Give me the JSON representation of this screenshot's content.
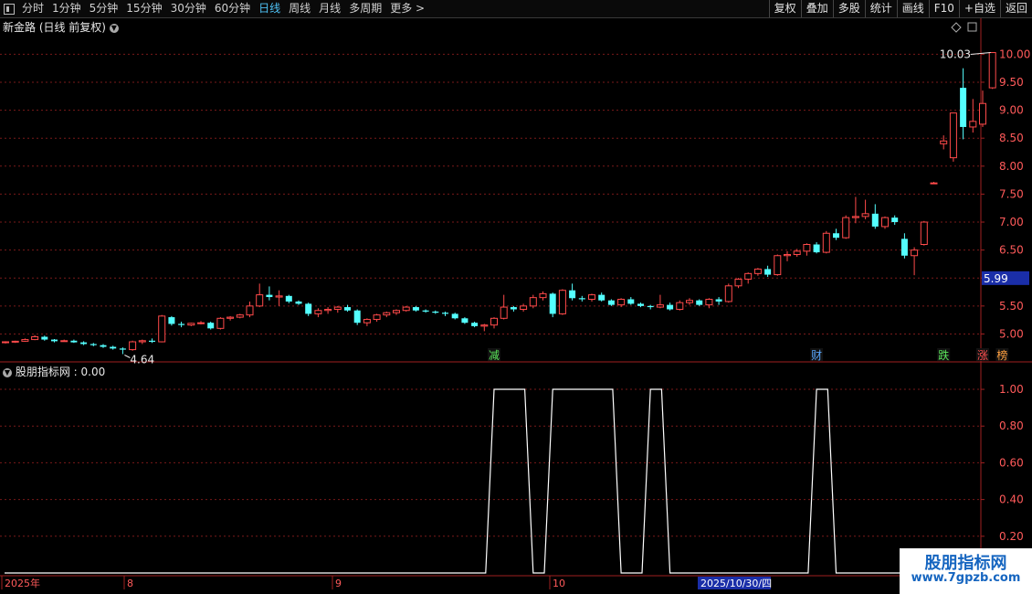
{
  "toolbar": {
    "periods": [
      "分时",
      "1分钟",
      "5分钟",
      "15分钟",
      "30分钟",
      "60分钟",
      "日线",
      "周线",
      "月线",
      "多周期",
      "更多 >"
    ],
    "active_period": "日线",
    "actions": [
      "复权",
      "叠加",
      "多股",
      "统计",
      "画线",
      "F10",
      "+自选",
      "返回"
    ]
  },
  "stock_title": "新金路 (日线 前复权)",
  "indicator_title": "股朋指标网 : 0.00",
  "watermark": {
    "line1": "股朋指标网",
    "line2": "www.7gpzb.com"
  },
  "colors": {
    "up": "#ff4a4a",
    "down": "#54ffff",
    "grid": "#7a1a1a",
    "axis": "#a02020",
    "line": "#ffffff",
    "price_tag_bg": "#1a2ea8"
  },
  "chart_data": [
    {
      "type": "candlestick",
      "title": "新金路 (日线 前复权)",
      "y_ticks": [
        "10.00",
        "9.50",
        "9.00",
        "8.50",
        "8.00",
        "7.50",
        "7.00",
        "6.50",
        "6.00",
        "5.50",
        "5.00"
      ],
      "ylim": [
        4.55,
        10.3
      ],
      "current_price_tag": "5.99",
      "annotations": {
        "high": "10.03",
        "low": "4.64"
      },
      "events": [
        {
          "index": 50,
          "label": "减",
          "color": "#5ce65c"
        },
        {
          "index": 83,
          "label": "财",
          "color": "#5aa8ff"
        },
        {
          "index": 96,
          "label": "跌",
          "color": "#5ce65c"
        },
        {
          "index": 100,
          "label": "涨",
          "color": "#ff5050"
        },
        {
          "index": 102,
          "label": "榜",
          "color": "#ffa040"
        }
      ],
      "candles": [
        [
          4.85,
          4.87,
          4.83,
          4.86
        ],
        [
          4.86,
          4.88,
          4.84,
          4.87
        ],
        [
          4.87,
          4.92,
          4.86,
          4.9
        ],
        [
          4.9,
          4.98,
          4.89,
          4.95
        ],
        [
          4.95,
          4.97,
          4.88,
          4.9
        ],
        [
          4.9,
          4.91,
          4.85,
          4.87
        ],
        [
          4.87,
          4.9,
          4.86,
          4.88
        ],
        [
          4.88,
          4.9,
          4.84,
          4.85
        ],
        [
          4.85,
          4.87,
          4.8,
          4.82
        ],
        [
          4.82,
          4.84,
          4.78,
          4.8
        ],
        [
          4.8,
          4.82,
          4.75,
          4.77
        ],
        [
          4.77,
          4.79,
          4.72,
          4.74
        ],
        [
          4.74,
          4.76,
          4.64,
          4.72
        ],
        [
          4.72,
          4.88,
          4.7,
          4.86
        ],
        [
          4.86,
          4.9,
          4.82,
          4.88
        ],
        [
          4.88,
          4.92,
          4.84,
          4.86
        ],
        [
          4.86,
          5.34,
          4.85,
          5.32
        ],
        [
          5.3,
          5.32,
          5.15,
          5.18
        ],
        [
          5.18,
          5.22,
          5.12,
          5.16
        ],
        [
          5.16,
          5.2,
          5.14,
          5.19
        ],
        [
          5.19,
          5.23,
          5.17,
          5.2
        ],
        [
          5.2,
          5.22,
          5.08,
          5.1
        ],
        [
          5.1,
          5.3,
          5.08,
          5.28
        ],
        [
          5.28,
          5.32,
          5.24,
          5.3
        ],
        [
          5.3,
          5.36,
          5.28,
          5.34
        ],
        [
          5.34,
          5.58,
          5.3,
          5.5
        ],
        [
          5.5,
          5.9,
          5.48,
          5.7
        ],
        [
          5.7,
          5.85,
          5.6,
          5.66
        ],
        [
          5.66,
          5.78,
          5.5,
          5.68
        ],
        [
          5.68,
          5.7,
          5.55,
          5.58
        ],
        [
          5.58,
          5.6,
          5.52,
          5.54
        ],
        [
          5.54,
          5.56,
          5.32,
          5.36
        ],
        [
          5.36,
          5.46,
          5.3,
          5.42
        ],
        [
          5.42,
          5.48,
          5.36,
          5.44
        ],
        [
          5.44,
          5.5,
          5.38,
          5.48
        ],
        [
          5.48,
          5.52,
          5.4,
          5.42
        ],
        [
          5.42,
          5.44,
          5.16,
          5.2
        ],
        [
          5.2,
          5.28,
          5.14,
          5.26
        ],
        [
          5.26,
          5.36,
          5.22,
          5.34
        ],
        [
          5.34,
          5.4,
          5.3,
          5.38
        ],
        [
          5.38,
          5.44,
          5.34,
          5.42
        ],
        [
          5.42,
          5.5,
          5.4,
          5.48
        ],
        [
          5.48,
          5.5,
          5.4,
          5.42
        ],
        [
          5.42,
          5.44,
          5.38,
          5.4
        ],
        [
          5.4,
          5.42,
          5.36,
          5.38
        ],
        [
          5.38,
          5.4,
          5.32,
          5.36
        ],
        [
          5.36,
          5.38,
          5.26,
          5.28
        ],
        [
          5.28,
          5.3,
          5.18,
          5.2
        ],
        [
          5.2,
          5.22,
          5.12,
          5.14
        ],
        [
          5.14,
          5.18,
          5.05,
          5.16
        ],
        [
          5.16,
          5.3,
          5.1,
          5.28
        ],
        [
          5.28,
          5.7,
          5.26,
          5.48
        ],
        [
          5.48,
          5.5,
          5.4,
          5.44
        ],
        [
          5.44,
          5.54,
          5.4,
          5.5
        ],
        [
          5.5,
          5.7,
          5.46,
          5.65
        ],
        [
          5.65,
          5.76,
          5.6,
          5.72
        ],
        [
          5.72,
          5.74,
          5.3,
          5.36
        ],
        [
          5.36,
          5.8,
          5.34,
          5.78
        ],
        [
          5.78,
          5.9,
          5.6,
          5.64
        ],
        [
          5.64,
          5.68,
          5.58,
          5.62
        ],
        [
          5.62,
          5.72,
          5.58,
          5.7
        ],
        [
          5.7,
          5.74,
          5.58,
          5.6
        ],
        [
          5.6,
          5.62,
          5.5,
          5.52
        ],
        [
          5.52,
          5.64,
          5.48,
          5.62
        ],
        [
          5.62,
          5.66,
          5.52,
          5.54
        ],
        [
          5.54,
          5.56,
          5.48,
          5.5
        ],
        [
          5.5,
          5.52,
          5.44,
          5.48
        ],
        [
          5.48,
          5.7,
          5.46,
          5.52
        ],
        [
          5.52,
          5.56,
          5.42,
          5.44
        ],
        [
          5.44,
          5.6,
          5.42,
          5.56
        ],
        [
          5.56,
          5.64,
          5.52,
          5.6
        ],
        [
          5.6,
          5.62,
          5.5,
          5.52
        ],
        [
          5.52,
          5.64,
          5.46,
          5.62
        ],
        [
          5.62,
          5.66,
          5.52,
          5.58
        ],
        [
          5.58,
          5.9,
          5.56,
          5.86
        ],
        [
          5.86,
          6.0,
          5.82,
          5.98
        ],
        [
          5.98,
          6.1,
          5.9,
          6.08
        ],
        [
          6.08,
          6.18,
          6.04,
          6.16
        ],
        [
          6.16,
          6.22,
          6.02,
          6.06
        ],
        [
          6.06,
          6.42,
          6.04,
          6.4
        ],
        [
          6.4,
          6.48,
          6.3,
          6.42
        ],
        [
          6.42,
          6.52,
          6.38,
          6.48
        ],
        [
          6.48,
          6.62,
          6.4,
          6.6
        ],
        [
          6.6,
          6.64,
          6.44,
          6.46
        ],
        [
          6.46,
          6.84,
          6.44,
          6.8
        ],
        [
          6.8,
          6.88,
          6.68,
          6.72
        ],
        [
          6.72,
          7.12,
          6.7,
          7.08
        ],
        [
          7.08,
          7.45,
          6.98,
          7.1
        ],
        [
          7.1,
          7.4,
          7.05,
          7.15
        ],
        [
          7.15,
          7.32,
          6.88,
          6.92
        ],
        [
          6.92,
          7.1,
          6.88,
          7.08
        ],
        [
          7.08,
          7.12,
          6.95,
          7.0
        ],
        [
          6.7,
          6.8,
          6.35,
          6.4
        ],
        [
          6.4,
          6.55,
          6.05,
          6.5
        ],
        [
          6.6,
          7.02,
          6.58,
          7.0
        ],
        [
          7.7,
          7.72,
          7.68,
          7.7
        ],
        [
          8.4,
          8.55,
          8.3,
          8.45
        ],
        [
          8.15,
          8.8,
          8.08,
          8.95
        ],
        [
          9.4,
          9.75,
          8.48,
          8.7
        ],
        [
          8.7,
          9.2,
          8.6,
          8.8
        ],
        [
          8.75,
          9.35,
          8.7,
          9.12
        ],
        [
          9.4,
          10.03,
          9.38,
          10.03
        ]
      ]
    },
    {
      "type": "line",
      "title": "股朋指标网",
      "y_ticks": [
        "1.00",
        "0.80",
        "0.60",
        "0.40",
        "0.20"
      ],
      "ylim": [
        0,
        1.05
      ],
      "x_labels": [
        "2025年",
        "8",
        "9",
        "10"
      ],
      "cursor_label": "2025/10/30/四",
      "spikes": [
        [
          50,
          53
        ],
        [
          56,
          62
        ],
        [
          66,
          67
        ],
        [
          83,
          84
        ]
      ]
    }
  ]
}
